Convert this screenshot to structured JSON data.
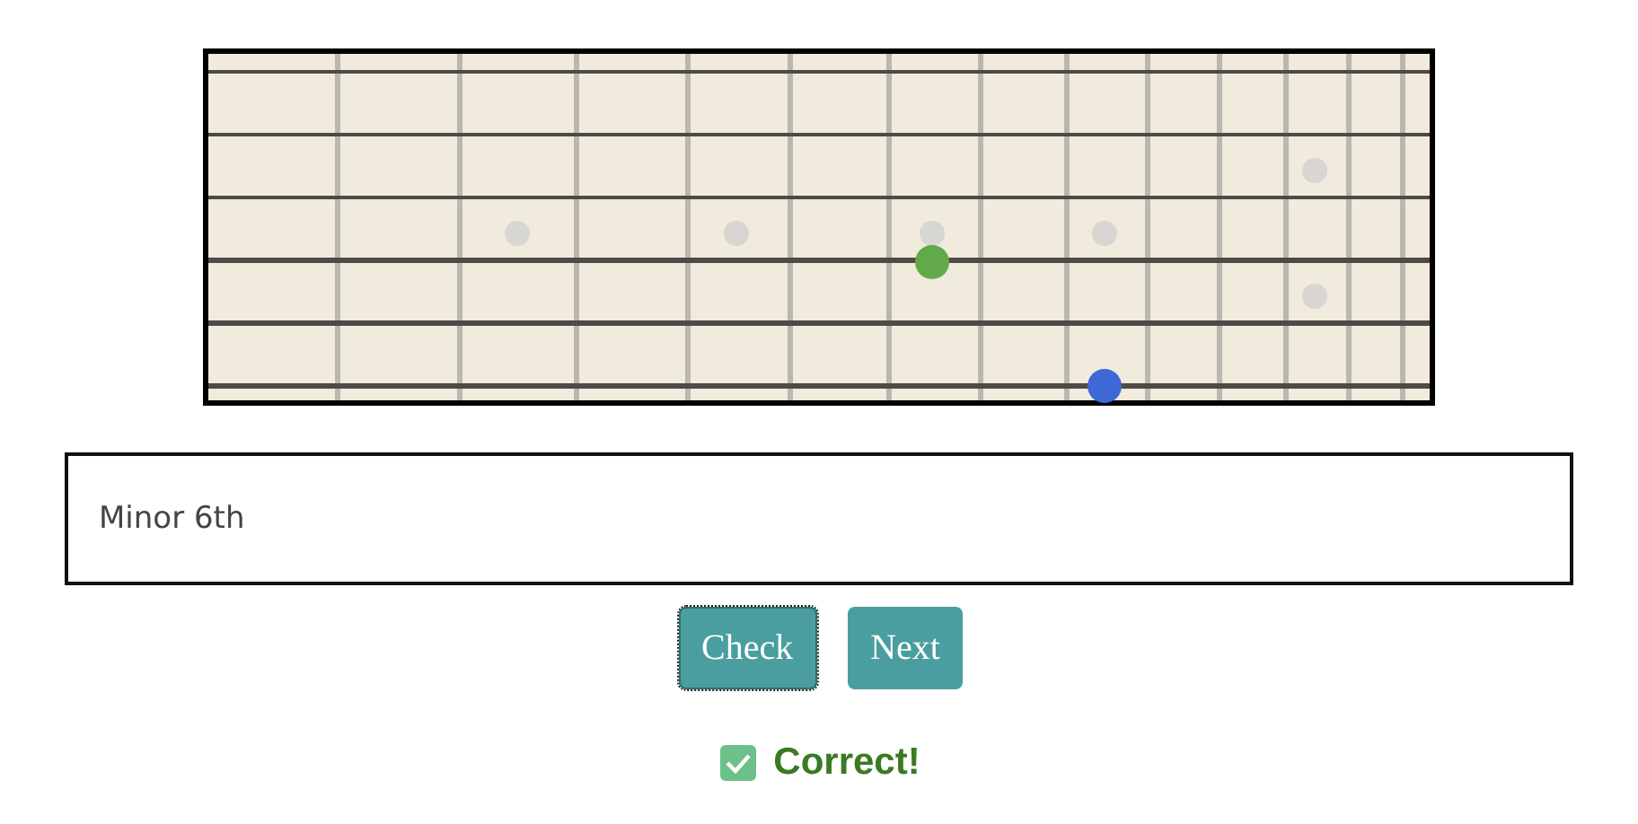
{
  "fretboard": {
    "notes": [
      {
        "color": "#62a94a"
      },
      {
        "color": "#3e68d6"
      }
    ]
  },
  "answer": {
    "value": "Minor 6th"
  },
  "buttons": [
    {
      "label": "Check",
      "focused": true
    },
    {
      "label": "Next",
      "focused": false
    }
  ],
  "feedback": {
    "correct": true,
    "text": "Correct!"
  }
}
